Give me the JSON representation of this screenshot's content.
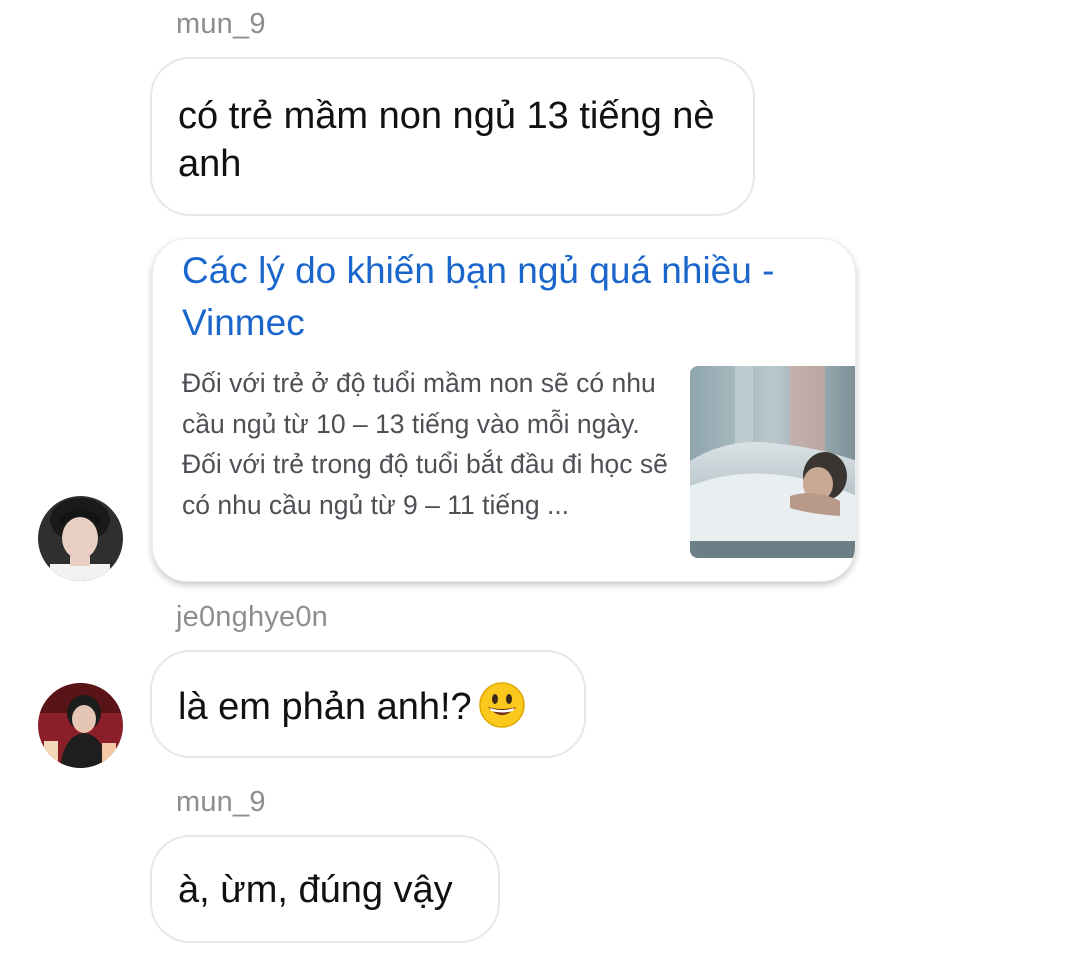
{
  "messages": [
    {
      "sender": "mun_9",
      "text": "có trẻ mầm non ngủ 13 tiếng nè anh"
    },
    {
      "link": {
        "title": "Các lý do khiến bạn ngủ quá nhiều - Vinmec",
        "snippet": "Đối với trẻ ở độ tuổi mầm non sẽ có nhu cầu ngủ từ 10 – 13 tiếng vào mỗi ngày. Đối với trẻ trong độ tuổi bắt đầu đi học sẽ có nhu cầu ngủ từ 9 – 11 tiếng ..."
      }
    },
    {
      "sender": "je0nghye0n",
      "text": "là em phản anh!?"
    },
    {
      "sender": "mun_9",
      "text": "à, ừm, đúng vậy"
    }
  ],
  "icons": {
    "emoji": "grinning-face-icon",
    "avatar_1": "avatar",
    "avatar_2": "avatar"
  },
  "colors": {
    "link_title": "#1a66cc",
    "sender_name": "#8e8e8e",
    "bubble_border": "#e7e7e7"
  }
}
